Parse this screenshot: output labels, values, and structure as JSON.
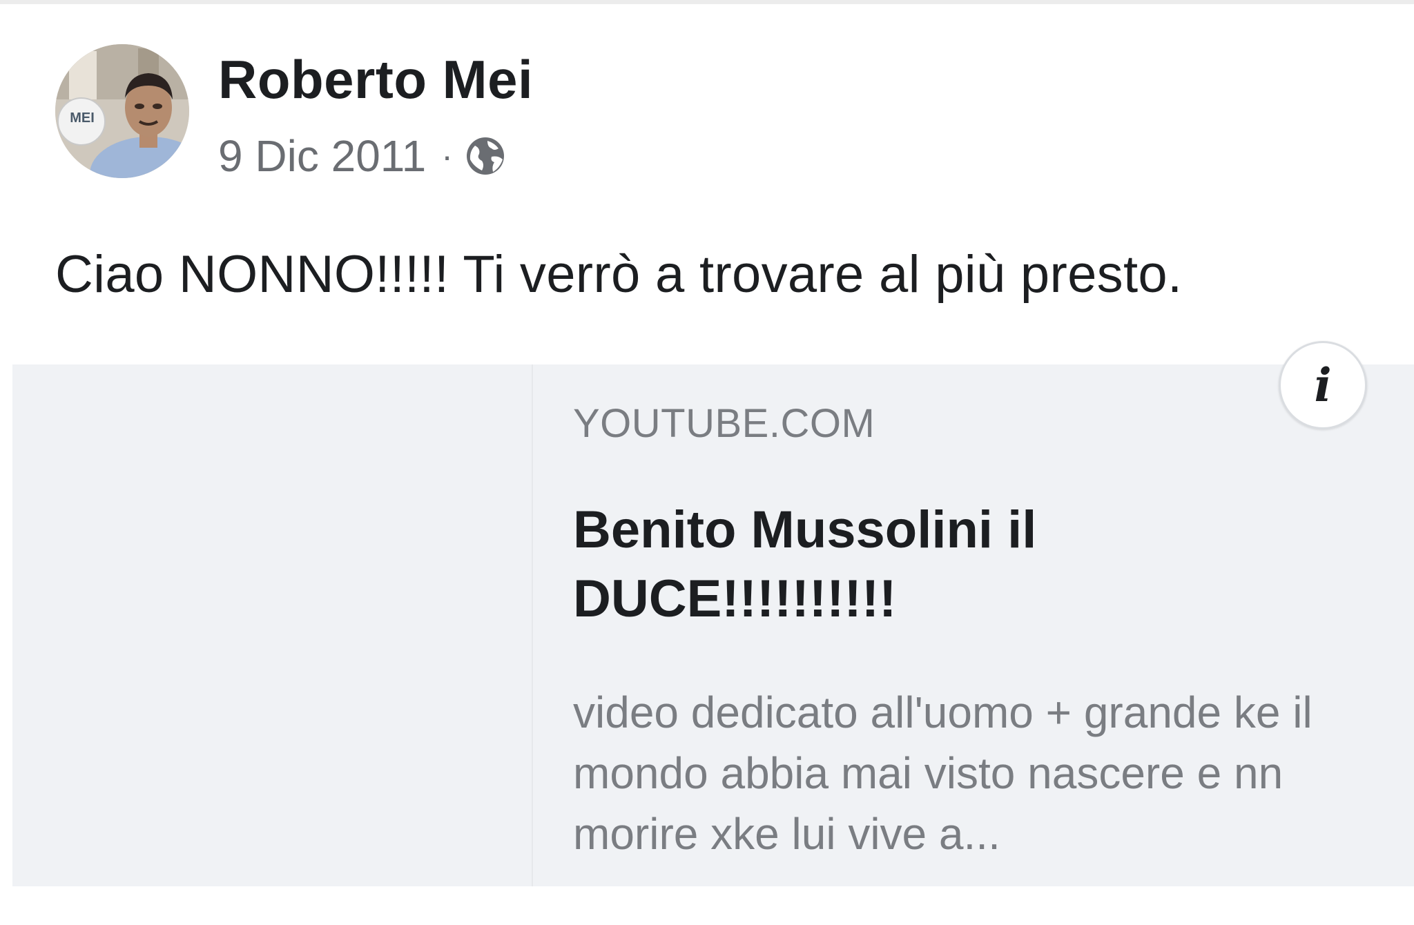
{
  "post": {
    "author": "Roberto Mei",
    "date": "9 Dic 2011",
    "separator": "·",
    "privacy_icon": "globe-icon",
    "text": "Ciao NONNO!!!!! Ti verrò a trovare al più presto."
  },
  "avatar": {
    "badge_text": "MEI"
  },
  "link_preview": {
    "domain": "YOUTUBE.COM",
    "title": "Benito Mussolini il DUCE!!!!!!!!!!",
    "description": "video dedicato all'uomo + grande ke il mondo abbia mai visto nascere e nn morire xke lui vive a...",
    "info_label": "i",
    "info_icon": "info-icon"
  },
  "colors": {
    "name_text": "#1c1e21",
    "meta_text": "#6a6d72",
    "card_background": "#f0f2f5",
    "card_secondary_text": "#7a7d82"
  }
}
